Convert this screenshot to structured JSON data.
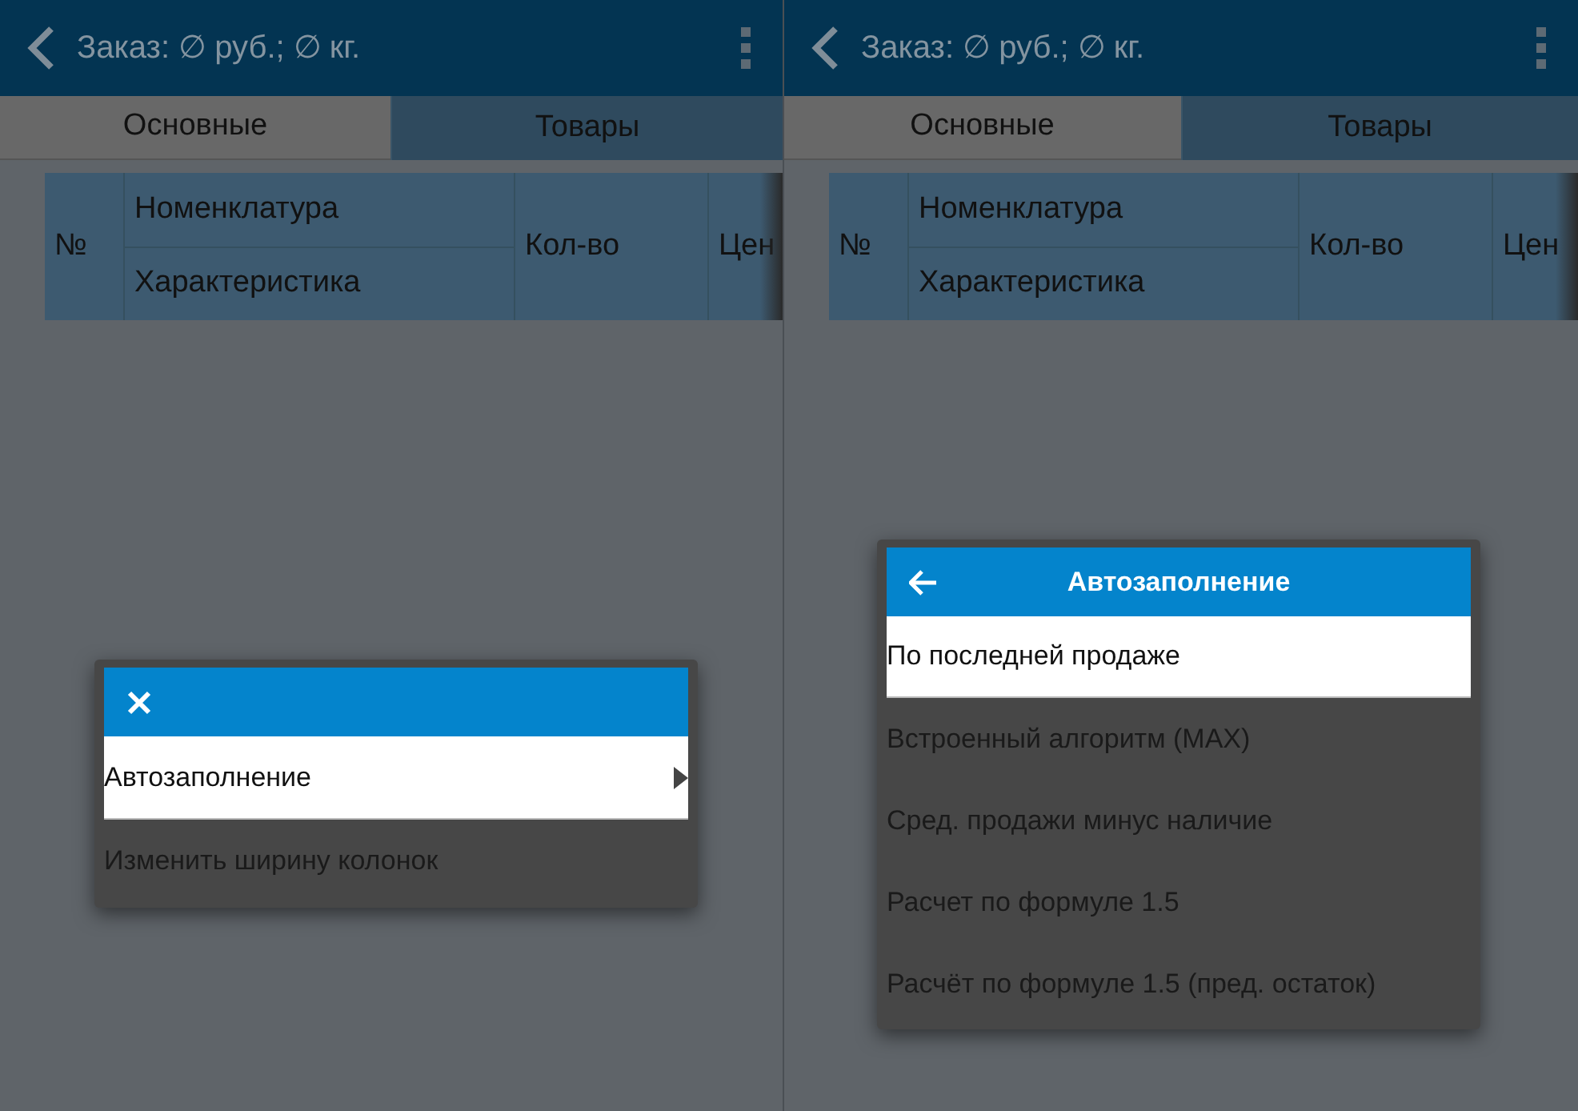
{
  "screens": [
    {
      "header": {
        "title": "Заказ: ∅ руб.; ∅ кг."
      },
      "tabs": [
        {
          "label": "Основные",
          "selected": true
        },
        {
          "label": "Товары",
          "selected": false
        }
      ],
      "table": {
        "columns": [
          {
            "kind": "single",
            "label": "№"
          },
          {
            "kind": "double",
            "labels": [
              "Номенклатура",
              "Характеристика"
            ]
          },
          {
            "kind": "single",
            "label": "Кол-во"
          },
          {
            "kind": "cut",
            "label": "Цен"
          }
        ]
      },
      "menu": {
        "kind": "close",
        "items": [
          {
            "label": "Автозаполнение",
            "selected": true,
            "submenu": true
          },
          {
            "label": "Изменить ширину колонок",
            "selected": false,
            "submenu": false
          }
        ]
      }
    },
    {
      "header": {
        "title": "Заказ: ∅ руб.; ∅ кг."
      },
      "tabs": [
        {
          "label": "Основные",
          "selected": true
        },
        {
          "label": "Товары",
          "selected": false
        }
      ],
      "table": {
        "columns": [
          {
            "kind": "single",
            "label": "№"
          },
          {
            "kind": "double",
            "labels": [
              "Номенклатура",
              "Характеристика"
            ]
          },
          {
            "kind": "single",
            "label": "Кол-во"
          },
          {
            "kind": "cut",
            "label": "Цен"
          }
        ]
      },
      "menu": {
        "kind": "back",
        "title": "Автозаполнение",
        "items": [
          {
            "label": "По последней продаже",
            "selected": true,
            "submenu": false
          },
          {
            "label": "Встроенный алгоритм (MAX)",
            "selected": false,
            "submenu": false
          },
          {
            "label": "Сред. продажи минус наличие",
            "selected": false,
            "submenu": false
          },
          {
            "label": "Расчет по формуле 1.5",
            "selected": false,
            "submenu": false
          },
          {
            "label": "Расчёт по формуле 1.5 (пред. остаток)",
            "selected": false,
            "submenu": false
          }
        ]
      }
    }
  ]
}
